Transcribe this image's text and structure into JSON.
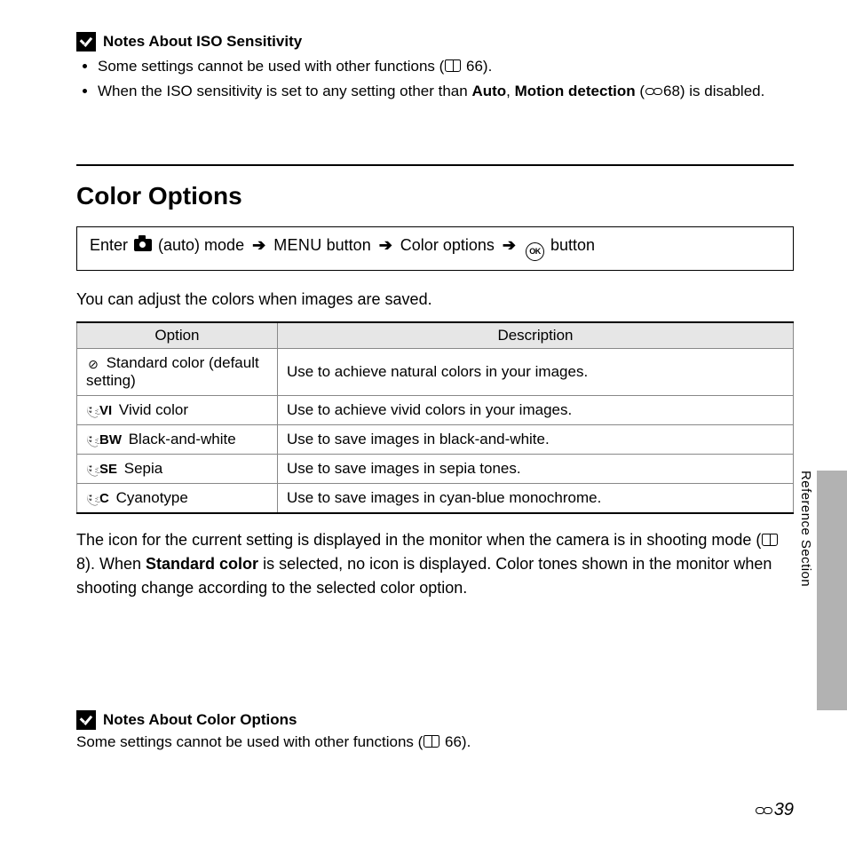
{
  "sideLabel": "Reference Section",
  "notesIso": {
    "title": "Notes About ISO Sensitivity",
    "bullet1a": "Some settings cannot be used with other functions (",
    "bullet1b": " 66).",
    "bullet2a": "When the ISO sensitivity is set to any setting other than ",
    "bullet2auto": "Auto",
    "bullet2b": ", ",
    "bullet2md": "Motion detection",
    "bullet2c": " (",
    "bullet2d": "68) is disabled."
  },
  "sectionTitle": "Color Options",
  "nav": {
    "a": "Enter ",
    "b": " (auto) mode ",
    "menu": "MENU",
    "c": " button ",
    "d": " Color options ",
    "ok": "OK",
    "e": " button"
  },
  "intro": "You can adjust the colors when images are saved.",
  "table": {
    "hOption": "Option",
    "hDesc": "Description",
    "rows": [
      {
        "sub": "",
        "icon": "◎",
        "name": "Standard color (default setting)",
        "desc": "Use to achieve natural colors in your images."
      },
      {
        "sub": "VI",
        "icon": "palette",
        "name": "Vivid color",
        "desc": "Use to achieve vivid colors in your images."
      },
      {
        "sub": "BW",
        "icon": "palette",
        "name": "Black-and-white",
        "desc": "Use to save images in black-and-white."
      },
      {
        "sub": "SE",
        "icon": "palette",
        "name": "Sepia",
        "desc": "Use to save images in sepia tones."
      },
      {
        "sub": "C",
        "icon": "palette",
        "name": "Cyanotype",
        "desc": "Use to save images in cyan-blue monochrome."
      }
    ]
  },
  "afterTable": {
    "a": "The icon for the current setting is displayed in the monitor when the camera is in shooting mode (",
    "b": " 8). When ",
    "sc": "Standard color",
    "c": " is selected, no icon is displayed. Color tones shown in the monitor when shooting change according to the selected color option."
  },
  "notesColor": {
    "title": "Notes About Color Options",
    "a": "Some settings cannot be used with other functions (",
    "b": " 66)."
  },
  "pageNum": "39"
}
